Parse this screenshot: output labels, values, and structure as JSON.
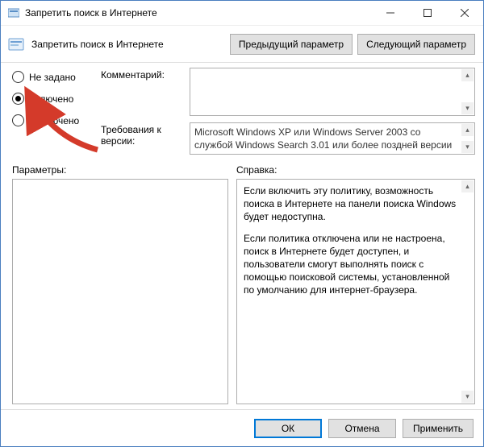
{
  "window": {
    "title": "Запретить поиск в Интернете"
  },
  "header": {
    "policy_title": "Запретить поиск в Интернете",
    "prev_btn": "Предыдущий параметр",
    "next_btn": "Следующий параметр"
  },
  "radio": {
    "not_configured": "Не задано",
    "enabled": "Включено",
    "disabled": "Отключено",
    "selected": "enabled"
  },
  "labels": {
    "comment": "Комментарий:",
    "requirements": "Требования к версии:",
    "options": "Параметры:",
    "help": "Справка:"
  },
  "requirements_text": "Microsoft Windows XP или Windows Server 2003 со службой Windows Search 3.01 или более поздней версии",
  "help": {
    "p1": "Если включить эту политику, возможность поиска в Интернете на панели поиска Windows будет недоступна.",
    "p2": "Если политика отключена или не настроена, поиск в Интернете будет доступен, и пользователи смогут выполнять поиск с помощью поисковой системы, установленной по умолчанию для интернет-браузера."
  },
  "footer": {
    "ok": "ОК",
    "cancel": "Отмена",
    "apply": "Применить"
  }
}
